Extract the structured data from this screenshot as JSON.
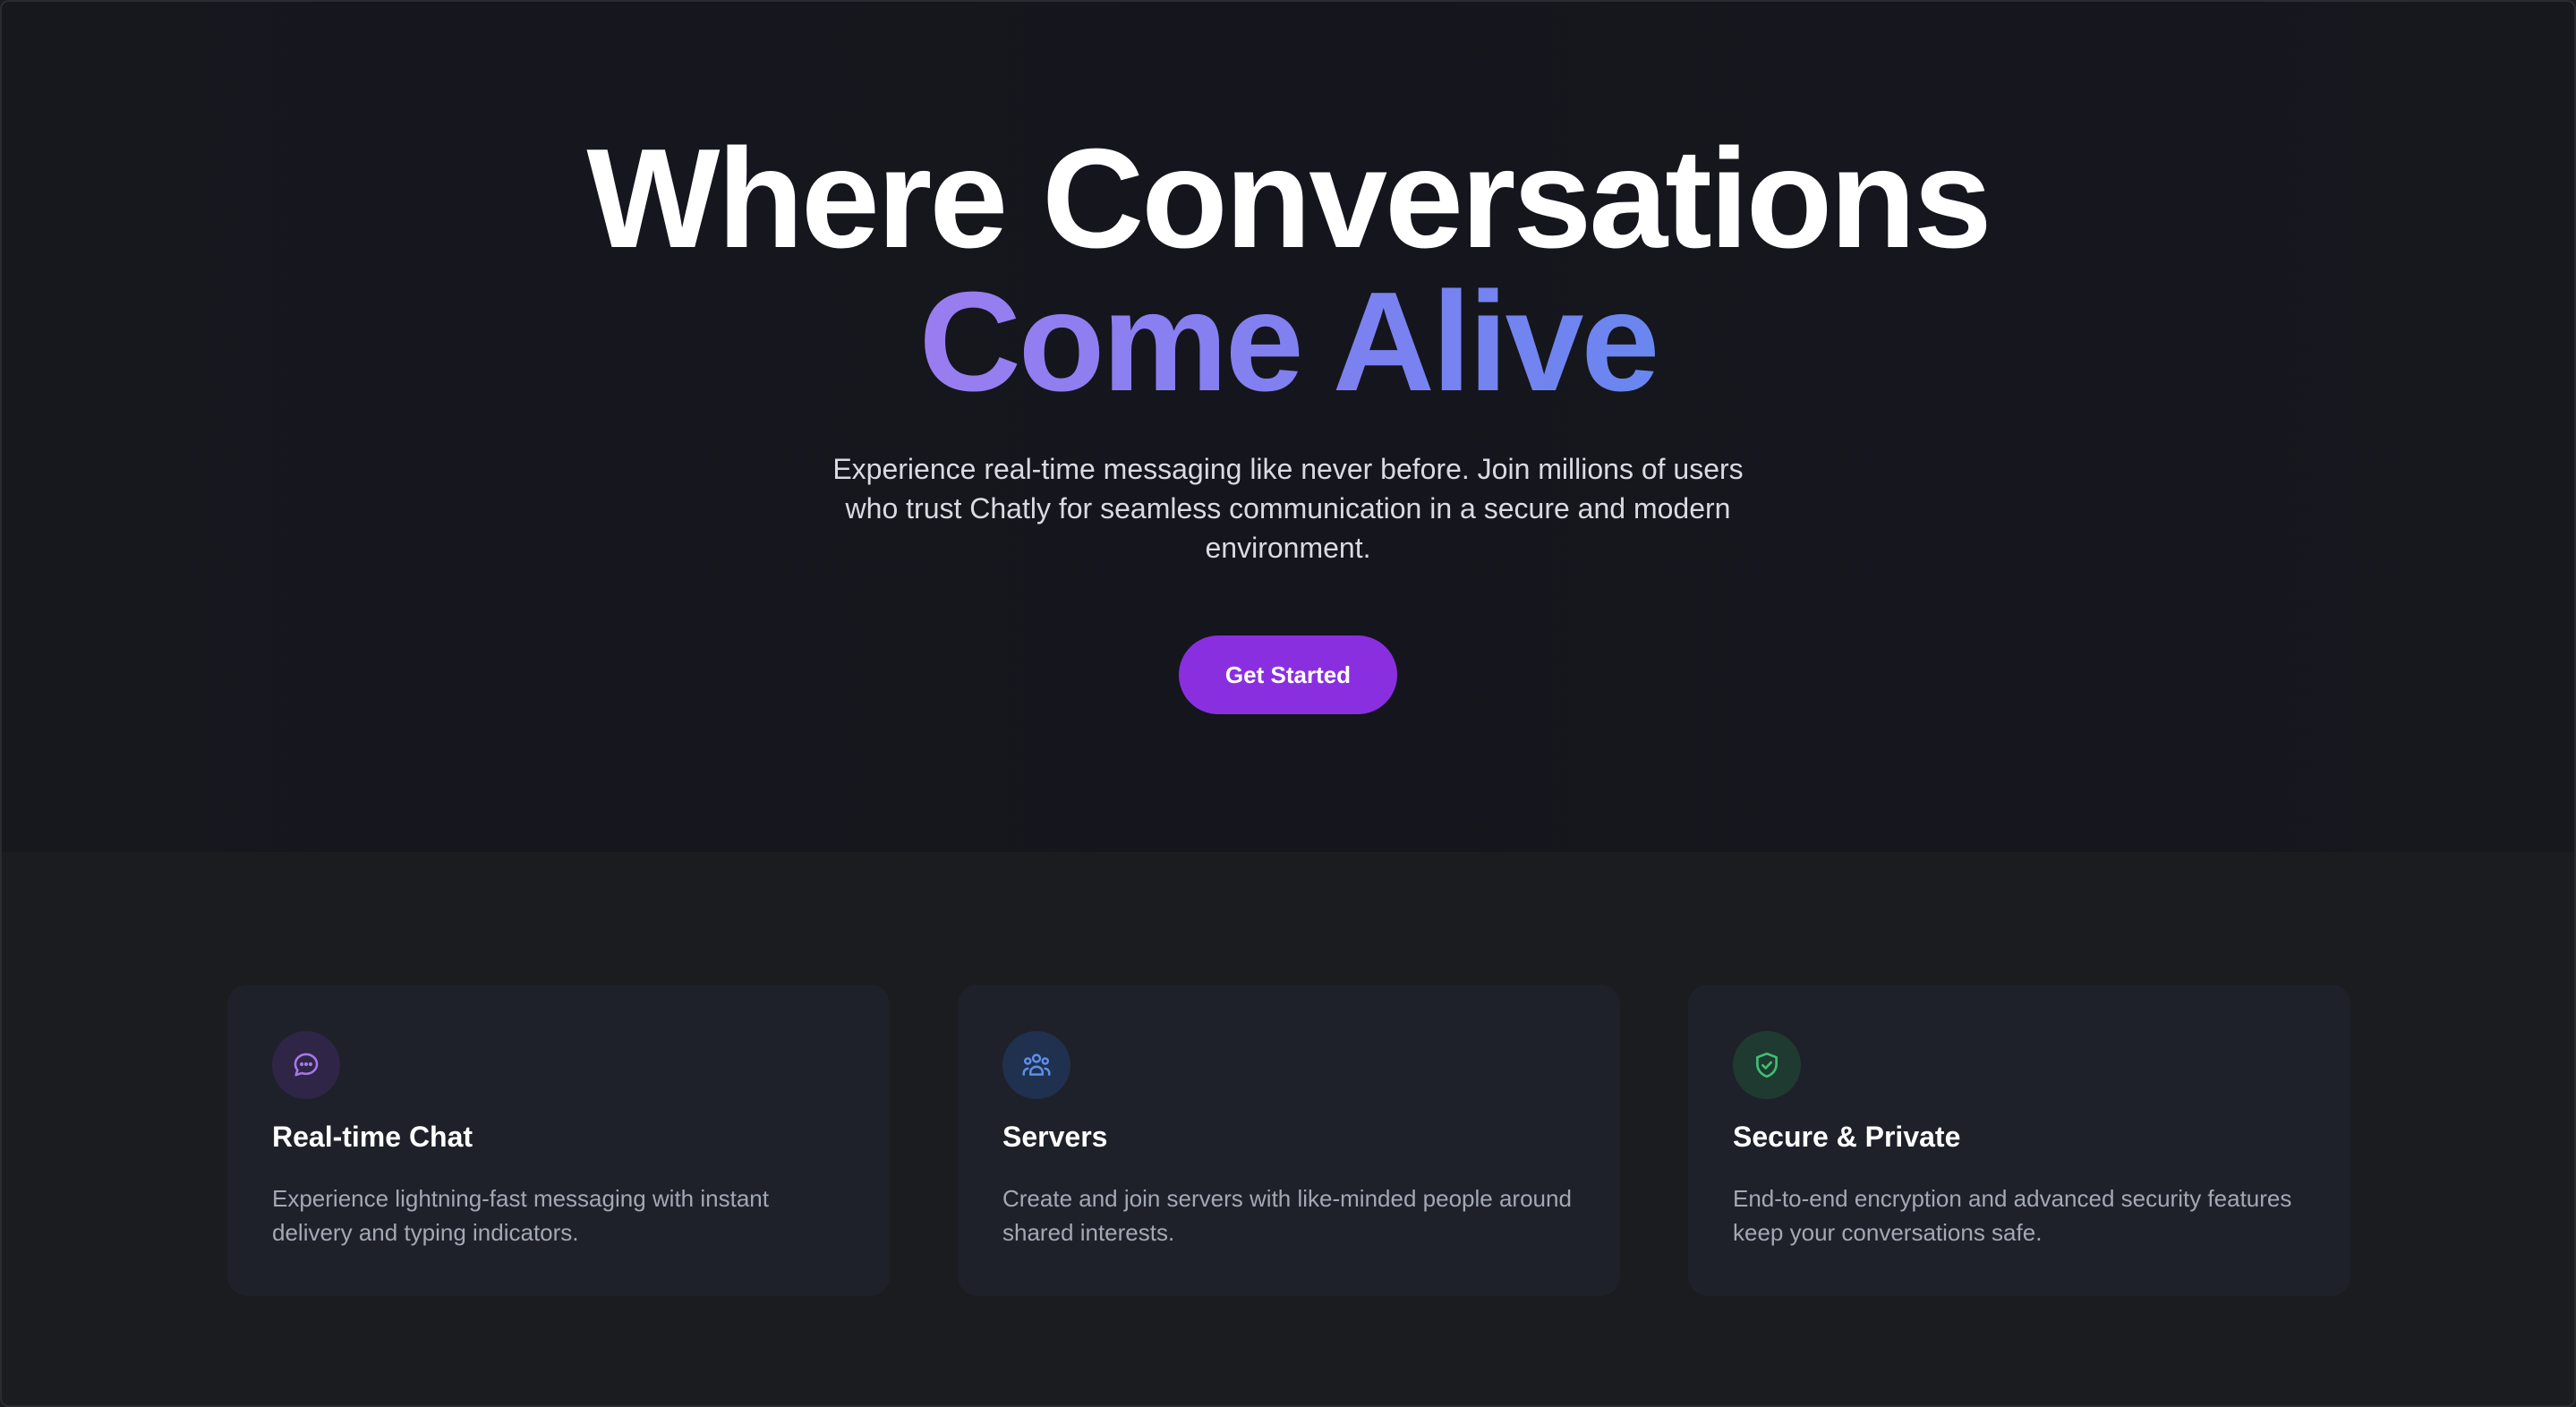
{
  "hero": {
    "title_line_1": "Where Conversations",
    "title_line_2": "Come Alive",
    "subtitle": "Experience real-time messaging like never before. Join millions of users who trust Chatly for seamless communication in a secure and modern environment.",
    "cta_label": "Get Started"
  },
  "features": [
    {
      "icon": "chat-bubble-icon",
      "title": "Real-time Chat",
      "description": "Experience lightning-fast messaging with instant delivery and typing indicators."
    },
    {
      "icon": "users-group-icon",
      "title": "Servers",
      "description": "Create and join servers with like-minded people around shared interests."
    },
    {
      "icon": "shield-check-icon",
      "title": "Secure & Private",
      "description": "End-to-end encryption and advanced security features keep your conversations safe."
    }
  ],
  "colors": {
    "accent": "#8a2fe0",
    "gradient_start": "#9a7df0",
    "gradient_end": "#6a86f0",
    "chat_icon": "#a777e8",
    "servers_icon": "#5c8fe6",
    "secure_icon": "#3fbf72"
  }
}
